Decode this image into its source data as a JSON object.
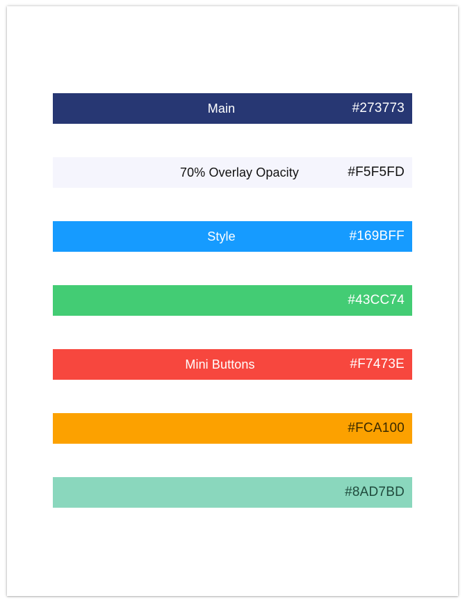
{
  "swatches": [
    {
      "label": "Main",
      "hex": "#273773",
      "bg": "#273773",
      "fg": "#ffffff",
      "label_offset": -16
    },
    {
      "label": "70% Overlay Opacity",
      "hex": "#F5F5FD",
      "bg": "#F5F5FD",
      "fg": "#111111",
      "label_offset": 10
    },
    {
      "label": "Style",
      "hex": "#169BFF",
      "bg": "#169BFF",
      "fg": "#ffffff",
      "label_offset": -16
    },
    {
      "label": "",
      "hex": "#43CC74",
      "bg": "#43CC74",
      "fg": "#ffffff",
      "label_offset": 0
    },
    {
      "label": "Mini Buttons",
      "hex": "#F7473E",
      "bg": "#F7473E",
      "fg": "#ffffff",
      "label_offset": -18
    },
    {
      "label": "",
      "hex": "#FCA100",
      "bg": "#FCA100",
      "fg": "#3a2a00",
      "label_offset": 0
    },
    {
      "label": "",
      "hex": "#8AD7BD",
      "bg": "#8AD7BD",
      "fg": "#1f4a3c",
      "label_offset": 0
    }
  ]
}
